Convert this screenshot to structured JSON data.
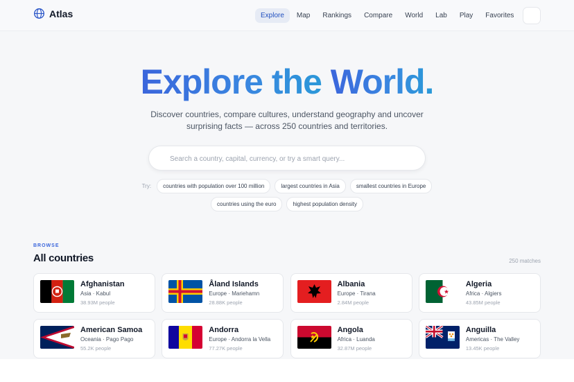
{
  "app": {
    "name": "Atlas",
    "logo_icon": "globe-icon"
  },
  "nav": {
    "items": [
      {
        "label": "Explore",
        "active": true
      },
      {
        "label": "Map",
        "active": false
      },
      {
        "label": "Rankings",
        "active": false
      },
      {
        "label": "Compare",
        "active": false
      },
      {
        "label": "World",
        "active": false
      },
      {
        "label": "Lab",
        "active": false
      },
      {
        "label": "Play",
        "active": false
      },
      {
        "label": "Favorites",
        "active": false
      }
    ],
    "theme_toggle_icon": "theme-toggle-icon"
  },
  "hero": {
    "title_part1": "Explore the ",
    "title_part2": "World.",
    "subtitle": "Discover countries, compare cultures, understand geography and uncover surprising facts — across 250 countries and territories."
  },
  "search": {
    "placeholder": "Search a country, capital, currency, or try a smart query...",
    "value": ""
  },
  "suggestions": {
    "label": "Try:",
    "row1": [
      "countries with population over 100 million",
      "largest countries in Asia",
      "smallest countries in Europe"
    ],
    "row2": [
      "countries using the euro",
      "highest population density"
    ]
  },
  "browse": {
    "eyebrow": "BROWSE",
    "title": "All countries",
    "matches": "250 matches"
  },
  "countries": [
    {
      "name": "Afghanistan",
      "region": "Asia · Kabul",
      "population": "38.93M people",
      "flag_icon": "afghanistan-flag-icon"
    },
    {
      "name": "Åland Islands",
      "region": "Europe · Mariehamn",
      "population": "28.88K people",
      "flag_icon": "aland-islands-flag-icon"
    },
    {
      "name": "Albania",
      "region": "Europe · Tirana",
      "population": "2.84M people",
      "flag_icon": "albania-flag-icon"
    },
    {
      "name": "Algeria",
      "region": "Africa · Algiers",
      "population": "43.85M people",
      "flag_icon": "algeria-flag-icon"
    },
    {
      "name": "American Samoa",
      "region": "Oceania · Pago Pago",
      "population": "55.2K people",
      "flag_icon": "american-samoa-flag-icon"
    },
    {
      "name": "Andorra",
      "region": "Europe · Andorra la Vella",
      "population": "77.27K people",
      "flag_icon": "andorra-flag-icon"
    },
    {
      "name": "Angola",
      "region": "Africa · Luanda",
      "population": "32.87M people",
      "flag_icon": "angola-flag-icon"
    },
    {
      "name": "Anguilla",
      "region": "Americas · The Valley",
      "population": "13.45K people",
      "flag_icon": "anguilla-flag-icon"
    }
  ],
  "colors": {
    "accent": "#3b66dc",
    "page_background": "#f6f7f9",
    "card_border": "#e5e7eb"
  }
}
